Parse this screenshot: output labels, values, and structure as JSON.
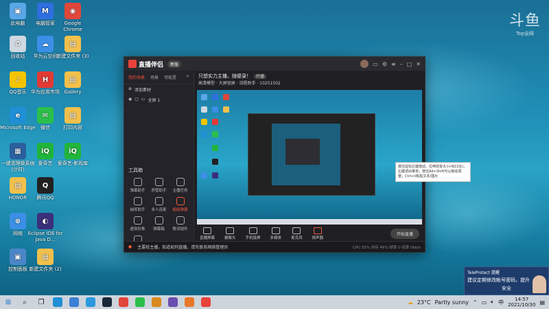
{
  "desktop": {
    "icons": [
      {
        "label": "此电脑",
        "color": "#5aa7e8",
        "glyph": "▣"
      },
      {
        "label": "电脑管家",
        "color": "#2f6fe0",
        "glyph": "M"
      },
      {
        "label": "Google Chrome",
        "color": "#e0463a",
        "glyph": "◉"
      },
      {
        "label": "回收站",
        "color": "#cfd8e0",
        "glyph": "♻"
      },
      {
        "label": "华为云空间",
        "color": "#3c8fe6",
        "glyph": "☁"
      },
      {
        "label": "新建文件夹 (3)",
        "color": "#f2c04c",
        "glyph": "▤"
      },
      {
        "label": "QQ音乐",
        "color": "#f4c400",
        "glyph": "♪"
      },
      {
        "label": "华为应用市场",
        "color": "#e23a35",
        "glyph": "H"
      },
      {
        "label": "Gallery",
        "color": "#f2c04c",
        "glyph": "▤"
      },
      {
        "label": "Microsoft Edge",
        "color": "#1f8fd6",
        "glyph": "e"
      },
      {
        "label": "微信",
        "color": "#2bbf4a",
        "glyph": "✉"
      },
      {
        "label": "打印内容",
        "color": "#f2c04c",
        "glyph": "▤"
      },
      {
        "label": "一键清理换系统(计时)",
        "color": "#2b5f9e",
        "glyph": "▦"
      },
      {
        "label": "爱奇艺",
        "color": "#20b53a",
        "glyph": "iQ"
      },
      {
        "label": "爱奇艺-影视库",
        "color": "#20b53a",
        "glyph": "iQ"
      },
      {
        "label": "HONOR",
        "color": "#f2c04c",
        "glyph": "▤"
      },
      {
        "label": "腾讯QQ",
        "color": "#222",
        "glyph": "Q"
      },
      {
        "label": "网络",
        "color": "#3c8fe6",
        "glyph": "⊕"
      },
      {
        "label": "Eclipse IDE for Java D...",
        "color": "#3a2f7a",
        "glyph": "◐"
      },
      {
        "label": "控制面板",
        "color": "#4a86c8",
        "glyph": "▣"
      },
      {
        "label": "新建文件夹 (2)",
        "color": "#f2c04c",
        "glyph": "▤"
      }
    ]
  },
  "watermark": {
    "main": "斗鱼",
    "sub": "Top全网"
  },
  "app": {
    "title": "直播伴侣",
    "version": "新版",
    "left_tabs": [
      "我的场景",
      "场景",
      "可能是"
    ],
    "scene_name": "全屏 1",
    "scene_add": "添加素材",
    "tools_title": "工具箱",
    "tools": [
      "弹幕助手",
      "房管助手",
      "主播任务",
      "抽奖助手",
      "多人连麦",
      "超级弹幕",
      "虚拟形象",
      "弹幕箱",
      "歌词插件",
      "直播助手"
    ],
    "main_line1": "只想实力主播，随便录！",
    "main_pill": "开播",
    "main_line2": "高清模型 · 大屏竖屏 · 流程助手 · 10251502",
    "tooltip": "按住鼠标左键拖动，拉伸改变大小(4比3比)，右键调出菜单；按住Alt+Shift可以拖动调整；Ctrl+V粘贴文本/图片",
    "controls": [
      "直播屏幕",
      "摄像头",
      "手机投屏",
      "多媒体",
      "麦克风",
      "扬声器"
    ],
    "start_label": "开始直播",
    "status_text": "主要给主播，知道如何直播，请先联系网络管理员",
    "stats": "CPU 25%  内存 46%  帧率 0  码率 0kb/s"
  },
  "notification": {
    "app": "TeleProtect 提醒",
    "line1": "建议定期修改帐号密码，提升",
    "line2": "安全"
  },
  "taskbar": {
    "weather_temp": "23°C",
    "weather_text": "Partly sunny",
    "time": "14:57",
    "date": "2021/10/30",
    "lang": "中"
  }
}
